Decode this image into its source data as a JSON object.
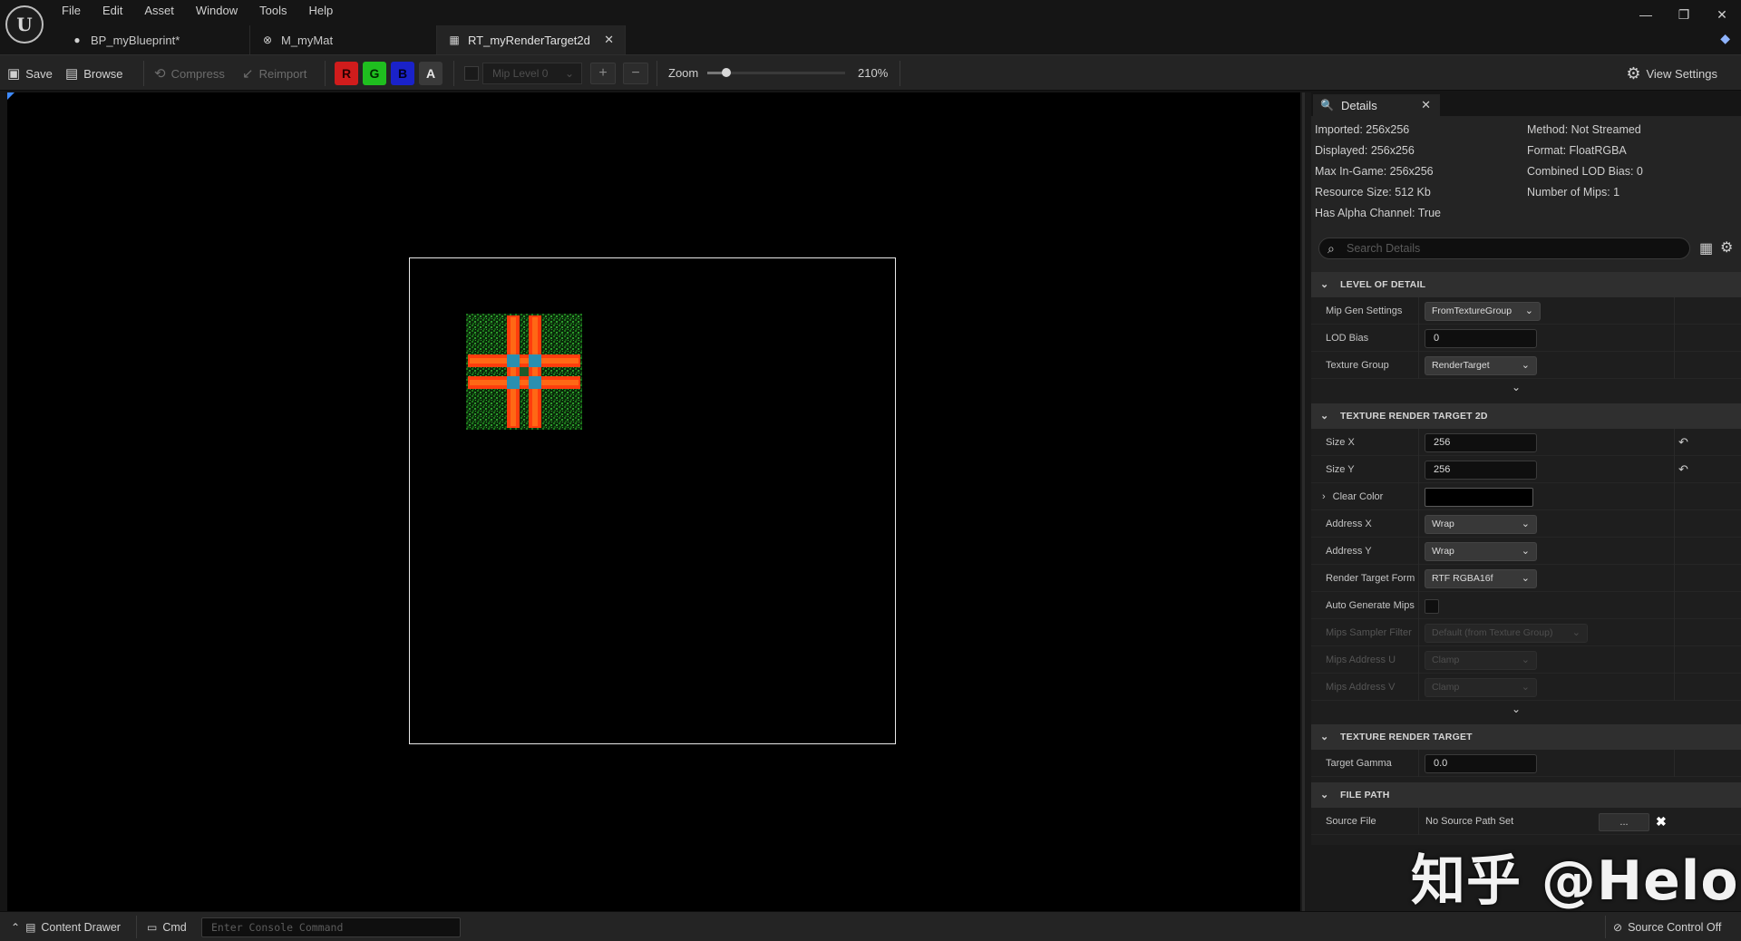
{
  "menu": [
    "File",
    "Edit",
    "Asset",
    "Window",
    "Tools",
    "Help"
  ],
  "tabs": [
    {
      "label": "BP_myBlueprint*",
      "icon": "blueprint-icon"
    },
    {
      "label": "M_myMat",
      "icon": "material-icon"
    },
    {
      "label": "RT_myRenderTarget2d",
      "icon": "texture-icon",
      "active": true
    }
  ],
  "toolbar": {
    "save": "Save",
    "browse": "Browse",
    "compress": "Compress",
    "reimport": "Reimport",
    "channels": {
      "r": "R",
      "g": "G",
      "b": "B",
      "a": "A"
    },
    "mip_level": "Mip Level 0",
    "zoom_label": "Zoom",
    "zoom_value": "210%",
    "zoom_fraction": 0.14,
    "view_settings": "View Settings"
  },
  "colors": {
    "red_channel": "#d01c1c",
    "green_channel": "#1fbf1f",
    "blue_channel": "#1a22c9",
    "accent": "#3e8aff"
  },
  "details": {
    "tab_title": "Details",
    "info_left": [
      "Imported: 256x256",
      "Displayed: 256x256",
      "Max In-Game: 256x256",
      "Resource Size: 512 Kb",
      "Has Alpha Channel: True"
    ],
    "info_right": [
      "Method: Not Streamed",
      "Format: FloatRGBA",
      "Combined LOD Bias: 0",
      "Number of Mips: 1"
    ],
    "search_placeholder": "Search Details",
    "sections": {
      "lod": {
        "title": "LEVEL OF DETAIL",
        "mip_gen_label": "Mip Gen Settings",
        "mip_gen_value": "FromTextureGroup",
        "lod_bias_label": "LOD Bias",
        "lod_bias_value": "0",
        "texture_group_label": "Texture Group",
        "texture_group_value": "RenderTarget"
      },
      "rt2d": {
        "title": "TEXTURE RENDER TARGET 2D",
        "size_x_label": "Size X",
        "size_x_value": "256",
        "size_y_label": "Size Y",
        "size_y_value": "256",
        "clear_color_label": "Clear Color",
        "address_x_label": "Address X",
        "address_x_value": "Wrap",
        "address_y_label": "Address Y",
        "address_y_value": "Wrap",
        "format_label": "Render Target Form",
        "format_value": "RTF RGBA16f",
        "auto_mips_label": "Auto Generate Mips",
        "mips_filter_label": "Mips Sampler Filter",
        "mips_filter_value": "Default (from Texture Group)",
        "mips_u_label": "Mips Address U",
        "mips_u_value": "Clamp",
        "mips_v_label": "Mips Address V",
        "mips_v_value": "Clamp"
      },
      "rt": {
        "title": "TEXTURE RENDER TARGET",
        "gamma_label": "Target Gamma",
        "gamma_value": "0.0"
      },
      "file": {
        "title": "FILE PATH",
        "source_label": "Source File",
        "source_value": "No Source Path Set",
        "browse_btn": "..."
      }
    }
  },
  "statusbar": {
    "content_drawer": "Content Drawer",
    "cmd": "Cmd",
    "console_placeholder": "Enter Console Command",
    "source_control": "Source Control Off"
  },
  "watermark": "知乎 @Helo"
}
